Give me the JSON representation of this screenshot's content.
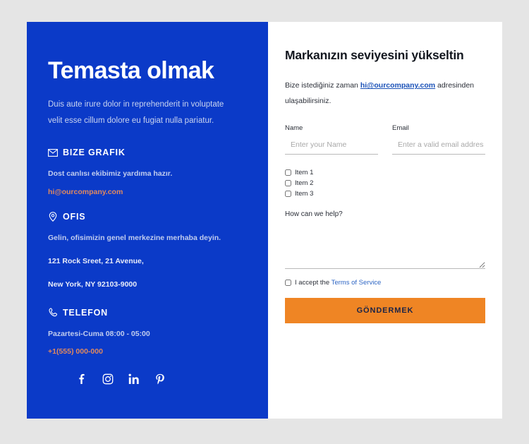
{
  "colors": {
    "panel_blue": "#0b3ac8",
    "accent_orange": "#ef8524",
    "page_background": "#e5e5e5",
    "link_blue": "#1b52b8",
    "blue_panel_link": "#e0895f"
  },
  "left_panel": {
    "title": "Temasta olmak",
    "description": "Duis aute irure dolor in reprehenderit in voluptate velit esse cillum dolore eu fugiat nulla pariatur.",
    "blocks": [
      {
        "icon": "envelope-icon",
        "heading": "BIZE GRAFIK",
        "text": "Dost canlısı ekibimiz yardıma hazır.",
        "link": "hi@ourcompany.com"
      },
      {
        "icon": "location-pin-icon",
        "heading": "OFIS",
        "text": "Gelin, ofisimizin genel merkezine merhaba deyin.",
        "address_line_1": "121 Rock Sreet, 21 Avenue,",
        "address_line_2": "New York, NY 92103-9000"
      },
      {
        "icon": "phone-icon",
        "heading": "TELEFON",
        "text": "Pazartesi-Cuma 08:00 - 05:00",
        "link": "+1(555) 000-000"
      }
    ],
    "social": [
      {
        "name": "facebook-icon",
        "label": "f"
      },
      {
        "name": "instagram-icon",
        "label": "Instagram"
      },
      {
        "name": "linkedin-icon",
        "label": "in"
      },
      {
        "name": "pinterest-icon",
        "label": "P"
      }
    ]
  },
  "form": {
    "title": "Markanızın seviyesini yükseltin",
    "intro_before": "Bize istediğiniz zaman ",
    "intro_link": "hi@ourcompany.com",
    "intro_after": " adresinden ulaşabilirsiniz.",
    "name_label": "Name",
    "name_placeholder": "Enter your Name",
    "name_value": "",
    "email_label": "Email",
    "email_placeholder": "Enter a valid email address",
    "email_value": "",
    "checkbox_items": [
      {
        "label": "Item 1",
        "checked": false
      },
      {
        "label": "Item 2",
        "checked": false
      },
      {
        "label": "Item 3",
        "checked": false
      }
    ],
    "message_label": "How can we help?",
    "message_value": "",
    "terms_text": "I accept the ",
    "terms_link": "Terms of Service",
    "terms_checked": false,
    "submit_label": "GÖNDERMEK"
  }
}
